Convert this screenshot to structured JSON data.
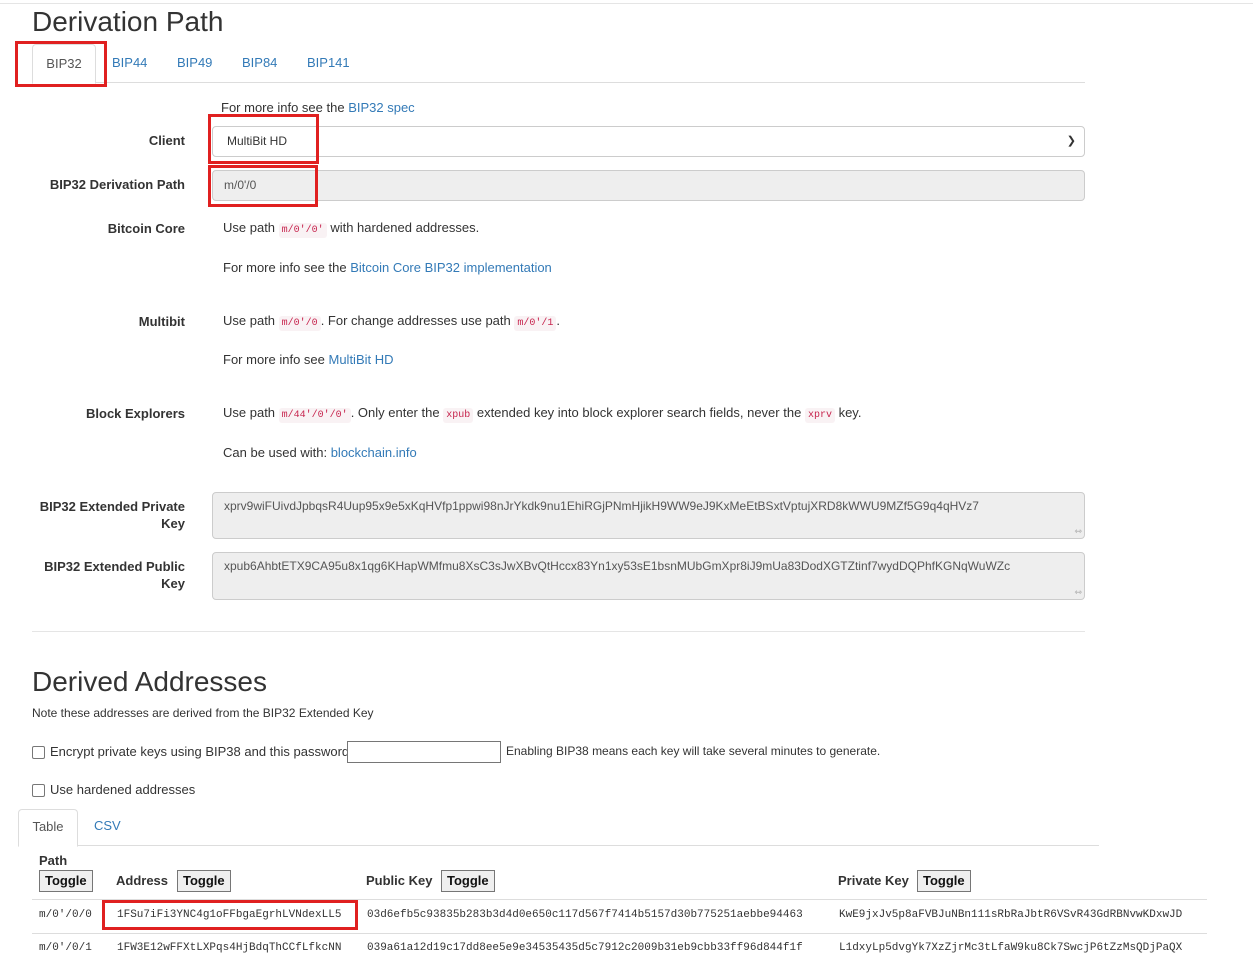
{
  "derivation": {
    "heading": "Derivation Path",
    "tabs": [
      "BIP32",
      "BIP44",
      "BIP49",
      "BIP84",
      "BIP141"
    ],
    "info_prefix": "For more info see the",
    "info_link": "BIP32 spec",
    "client_label": "Client",
    "client_value": "MultiBit HD",
    "path_label": "BIP32 Derivation Path",
    "path_value": "m/0'/0",
    "bitcoin_core": {
      "label": "Bitcoin Core",
      "use_path": "Use path",
      "code": "m/0'/0'",
      "suffix": "with hardened addresses.",
      "info_prefix": "For more info see the",
      "info_link": "Bitcoin Core BIP32 implementation"
    },
    "multibit": {
      "label": "Multibit",
      "use_path": "Use path",
      "code1": "m/0'/0",
      "mid": ". For change addresses use path",
      "code2": "m/0'/1",
      "end": ".",
      "info_prefix": "For more info see",
      "info_link": "MultiBit HD"
    },
    "block_explorers": {
      "label": "Block Explorers",
      "use_path": "Use path",
      "code1": "m/44'/0'/0'",
      "mid": ". Only enter the",
      "code2": "xpub",
      "mid2": "extended key into block explorer search fields, never the",
      "code3": "xprv",
      "end": "key.",
      "used_prefix": "Can be used with:",
      "used_link": "blockchain.info"
    },
    "xprv_label": "BIP32 Extended Private Key",
    "xprv_value": "xprv9wiFUivdJpbqsR4Uup95x9e5xKqHVfp1ppwi98nJrYkdk9nu1EhiRGjPNmHjikH9WW9eJ9KxMeEtBSxtVptujXRD8kWWU9MZf5G9q4qHVz7",
    "xpub_label": "BIP32 Extended Public Key",
    "xpub_value": "xpub6AhbtETX9CA95u8x1qg6KHapWMfmu8XsC3sJwXBvQtHccx83Yn1xy53sE1bsnMUbGmXpr8iJ9mUa83DodXGTZtinf7wydDQPhfKGNqWuWZc"
  },
  "derived": {
    "heading": "Derived Addresses",
    "note": "Note these addresses are derived from the BIP32 Extended Key",
    "bip38_label": "Encrypt private keys using BIP38 and this password:",
    "bip38_note": "Enabling BIP38 means each key will take several minutes to generate.",
    "hardened_label": "Use hardened addresses",
    "tabs": [
      "Table",
      "CSV"
    ],
    "columns": {
      "path": "Path",
      "address": "Address",
      "public_key": "Public Key",
      "private_key": "Private Key"
    },
    "toggle_label": "Toggle",
    "rows": [
      {
        "path": "m/0'/0/0",
        "address": "1FSu7iFi3YNC4g1oFFbgaEgrhLVNdexLL5",
        "public_key": "03d6efb5c93835b283b3d4d0e650c117d567f7414b5157d30b775251aebbe94463",
        "private_key": "KwE9jxJv5p8aFVBJuNBn111sRbRaJbtR6VSvR43GdRBNvwKDxwJD"
      },
      {
        "path": "m/0'/0/1",
        "address": "1FW3E12wFFXtLXPqs4HjBdqThCCfLfkcNN",
        "public_key": "039a61a12d19c17dd8ee5e9e34535435d5c7912c2009b31eb9cbb33ff96d844f1f",
        "private_key": "L1dxyLp5dvgYk7XzZjrMc3tLfaW9ku8Ck7SwcjP6tZzMsQDjPaQX"
      }
    ]
  }
}
